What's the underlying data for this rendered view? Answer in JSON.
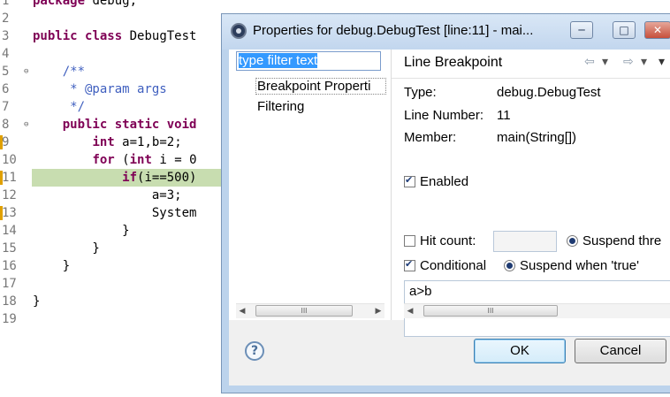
{
  "editor": {
    "lines": [
      {
        "n": "1",
        "code": "package debug;"
      },
      {
        "n": "2",
        "code": ""
      },
      {
        "n": "3",
        "code": "public class DebugTest"
      },
      {
        "n": "4",
        "code": ""
      },
      {
        "n": "5",
        "code": "    /**"
      },
      {
        "n": "6",
        "code": "     * @param args"
      },
      {
        "n": "7",
        "code": "     */"
      },
      {
        "n": "8",
        "code": "    public static void"
      },
      {
        "n": "9",
        "code": "        int a=1,b=2;"
      },
      {
        "n": "10",
        "code": "        for (int i = 0"
      },
      {
        "n": "11",
        "code": "            if(i==500)"
      },
      {
        "n": "12",
        "code": "                a=3;"
      },
      {
        "n": "13",
        "code": "                System"
      },
      {
        "n": "14",
        "code": "            }"
      },
      {
        "n": "15",
        "code": "        }"
      },
      {
        "n": "16",
        "code": "    }"
      },
      {
        "n": "17",
        "code": ""
      },
      {
        "n": "18",
        "code": "}"
      },
      {
        "n": "19",
        "code": ""
      }
    ]
  },
  "dialog": {
    "title": "Properties for debug.DebugTest [line:11] - mai...",
    "title_buttons": {
      "minimize": "─",
      "maximize": "□",
      "close": "✕"
    },
    "filter_text": "type filter text",
    "tree_items": [
      "Breakpoint Properti",
      "Filtering"
    ],
    "page_title": "Line Breakpoint",
    "nav_icons": {
      "back": "⇦",
      "back_menu": "▾",
      "forward": "⇨",
      "forward_menu": "▾",
      "view_menu": "▾"
    },
    "fields": {
      "type_label": "Type:",
      "type_value": "debug.DebugTest",
      "line_label": "Line Number:",
      "line_value": "11",
      "member_label": "Member:",
      "member_value": "main(String[])"
    },
    "enabled_label": "Enabled",
    "enabled_checked": true,
    "hit_count_label": "Hit count:",
    "hit_count_checked": false,
    "hit_count_value": "",
    "suspend_thread_label": "Suspend thre",
    "conditional_label": "Conditional",
    "conditional_checked": true,
    "suspend_true_label": "Suspend when 'true'",
    "condition_text": "a>b",
    "scroll_thumb": "III",
    "help_glyph": "?",
    "ok_label": "OK",
    "cancel_label": "Cancel"
  }
}
